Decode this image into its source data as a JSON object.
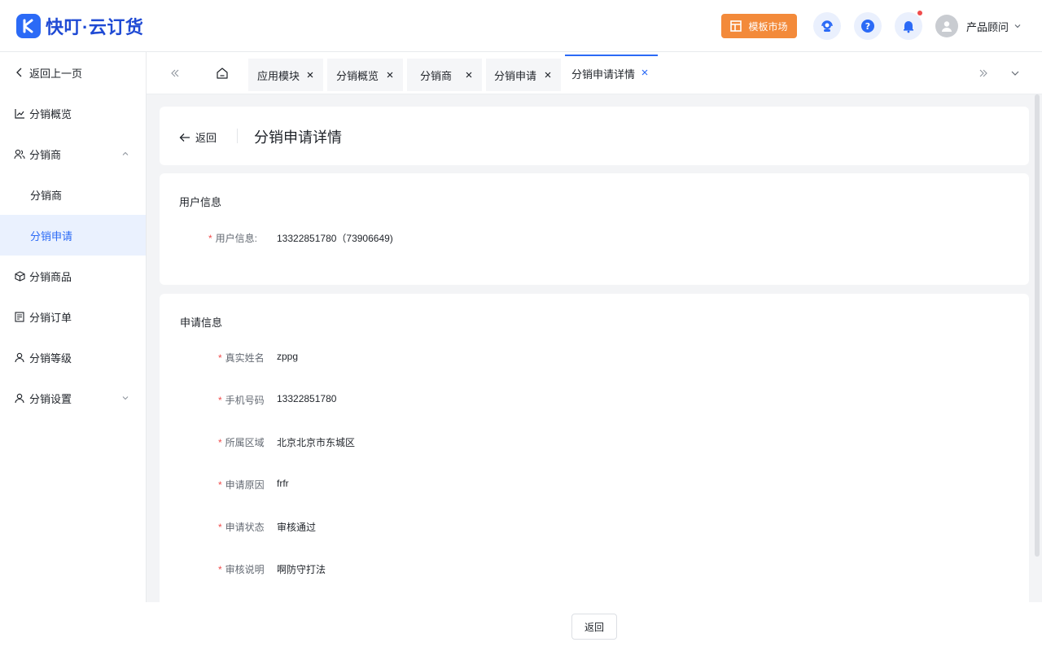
{
  "app": {
    "brand": "快叮·云订货"
  },
  "header": {
    "template_market": "模板市场",
    "user_name": "产品顾问"
  },
  "sidebar": {
    "back": "返回上一页",
    "items": [
      {
        "label": "分销概览",
        "icon": "trend-icon"
      },
      {
        "label": "分销商",
        "icon": "users-icon"
      },
      {
        "label": "分销商"
      },
      {
        "label": "分销申请"
      },
      {
        "label": "分销商品",
        "icon": "box-icon"
      },
      {
        "label": "分销订单",
        "icon": "order-icon"
      },
      {
        "label": "分销等级",
        "icon": "user-icon"
      },
      {
        "label": "分销设置",
        "icon": "user-settings-icon"
      }
    ]
  },
  "tabs": [
    {
      "label": "应用模块"
    },
    {
      "label": "分销概览"
    },
    {
      "label": "分销商"
    },
    {
      "label": "分销申请"
    },
    {
      "label": "分销申请详情",
      "active": true
    }
  ],
  "page": {
    "back_label": "返回",
    "title": "分销申请详情"
  },
  "user_section": {
    "title": "用户信息",
    "label": "用户信息:",
    "value": "13322851780（73906649)"
  },
  "apply_section": {
    "title": "申请信息",
    "fields": [
      {
        "label": "真实姓名",
        "value": "zppg"
      },
      {
        "label": "手机号码",
        "value": "13322851780"
      },
      {
        "label": "所属区域",
        "value": "北京北京市东城区"
      },
      {
        "label": "申请原因",
        "value": "frfr"
      },
      {
        "label": "申请状态",
        "value": "审核通过"
      },
      {
        "label": "审核说明",
        "value": "啊防守打法"
      }
    ]
  },
  "footer": {
    "back_button": "返回"
  },
  "colors": {
    "accent": "#2b6af6",
    "orange": "#f38a3a",
    "required": "#f04c4c"
  }
}
